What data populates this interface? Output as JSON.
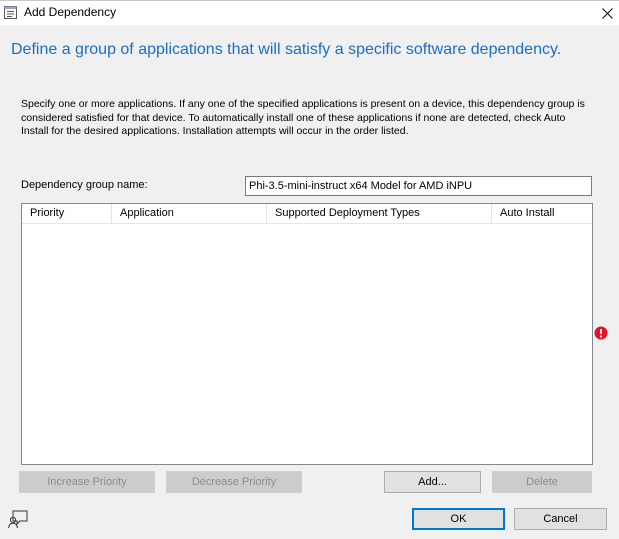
{
  "window": {
    "title": "Add Dependency",
    "close_glyph": "✕"
  },
  "heading": "Define a group of applications that will satisfy a specific software dependency.",
  "description": "Specify one or more applications. If any one of the specified applications is present on a device, this dependency group is considered satisfied for that device. To automatically install one of these applications if none are detected, check Auto Install for the desired applications. Installation attempts will occur in the order listed.",
  "group_name": {
    "label": "Dependency group name:",
    "value": "Phi-3.5-mini-instruct x64 Model for AMD iNPU"
  },
  "list": {
    "columns": [
      {
        "label": "Priority"
      },
      {
        "label": "Application"
      },
      {
        "label": "Supported Deployment Types"
      },
      {
        "label": "Auto Install"
      }
    ],
    "rows": []
  },
  "buttons": {
    "increase_priority": "Increase Priority",
    "decrease_priority": "Decrease Priority",
    "add": "Add...",
    "delete": "Delete",
    "ok": "OK",
    "cancel": "Cancel"
  },
  "icons": {
    "window_icon": "dialog-list-icon",
    "error_icon": "error-icon",
    "feedback_icon": "feedback-icon"
  },
  "colors": {
    "heading": "#1a6fc4",
    "error": "#e81123",
    "default_button_border": "#0078d7"
  }
}
